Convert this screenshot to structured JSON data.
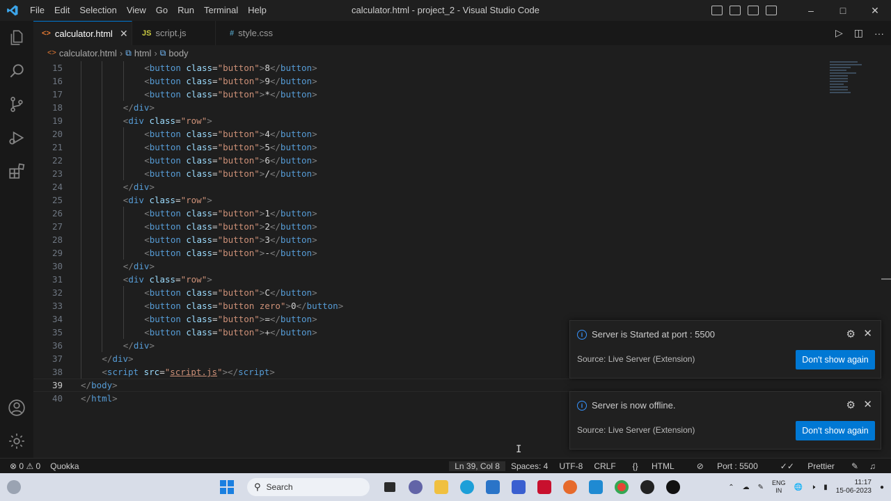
{
  "window": {
    "title": "calculator.html - project_2 - Visual Studio Code",
    "menu": [
      "File",
      "Edit",
      "Selection",
      "View",
      "Go",
      "Run",
      "Terminal",
      "Help"
    ]
  },
  "tabs": [
    {
      "label": "calculator.html",
      "icon": "<>",
      "active": true
    },
    {
      "label": "script.js",
      "icon": "JS",
      "active": false
    },
    {
      "label": "style.css",
      "icon": "#",
      "active": false
    }
  ],
  "breadcrumb": [
    "calculator.html",
    "html",
    "body"
  ],
  "editor": {
    "current_line": 39,
    "lines": [
      {
        "n": "15",
        "indent": 3,
        "tokens": [
          [
            "brk",
            "<"
          ],
          [
            "tag",
            "button"
          ],
          [
            "txt",
            " "
          ],
          [
            "attr",
            "class"
          ],
          [
            "txt",
            "="
          ],
          [
            "str",
            "\"button\""
          ],
          [
            "brk",
            ">"
          ],
          [
            "txt",
            "8"
          ],
          [
            "brk",
            "</"
          ],
          [
            "tag",
            "button"
          ],
          [
            "brk",
            ">"
          ]
        ]
      },
      {
        "n": "16",
        "indent": 3,
        "tokens": [
          [
            "brk",
            "<"
          ],
          [
            "tag",
            "button"
          ],
          [
            "txt",
            " "
          ],
          [
            "attr",
            "class"
          ],
          [
            "txt",
            "="
          ],
          [
            "str",
            "\"button\""
          ],
          [
            "brk",
            ">"
          ],
          [
            "txt",
            "9"
          ],
          [
            "brk",
            "</"
          ],
          [
            "tag",
            "button"
          ],
          [
            "brk",
            ">"
          ]
        ]
      },
      {
        "n": "17",
        "indent": 3,
        "tokens": [
          [
            "brk",
            "<"
          ],
          [
            "tag",
            "button"
          ],
          [
            "txt",
            " "
          ],
          [
            "attr",
            "class"
          ],
          [
            "txt",
            "="
          ],
          [
            "str",
            "\"button\""
          ],
          [
            "brk",
            ">"
          ],
          [
            "txt",
            "*"
          ],
          [
            "brk",
            "</"
          ],
          [
            "tag",
            "button"
          ],
          [
            "brk",
            ">"
          ]
        ]
      },
      {
        "n": "18",
        "indent": 2,
        "tokens": [
          [
            "brk",
            "</"
          ],
          [
            "tag",
            "div"
          ],
          [
            "brk",
            ">"
          ]
        ]
      },
      {
        "n": "19",
        "indent": 2,
        "tokens": [
          [
            "brk",
            "<"
          ],
          [
            "tag",
            "div"
          ],
          [
            "txt",
            " "
          ],
          [
            "attr",
            "class"
          ],
          [
            "txt",
            "="
          ],
          [
            "str",
            "\"row\""
          ],
          [
            "brk",
            ">"
          ]
        ]
      },
      {
        "n": "20",
        "indent": 3,
        "tokens": [
          [
            "brk",
            "<"
          ],
          [
            "tag",
            "button"
          ],
          [
            "txt",
            " "
          ],
          [
            "attr",
            "class"
          ],
          [
            "txt",
            "="
          ],
          [
            "str",
            "\"button\""
          ],
          [
            "brk",
            ">"
          ],
          [
            "txt",
            "4"
          ],
          [
            "brk",
            "</"
          ],
          [
            "tag",
            "button"
          ],
          [
            "brk",
            ">"
          ]
        ]
      },
      {
        "n": "21",
        "indent": 3,
        "tokens": [
          [
            "brk",
            "<"
          ],
          [
            "tag",
            "button"
          ],
          [
            "txt",
            " "
          ],
          [
            "attr",
            "class"
          ],
          [
            "txt",
            "="
          ],
          [
            "str",
            "\"button\""
          ],
          [
            "brk",
            ">"
          ],
          [
            "txt",
            "5"
          ],
          [
            "brk",
            "</"
          ],
          [
            "tag",
            "button"
          ],
          [
            "brk",
            ">"
          ]
        ]
      },
      {
        "n": "22",
        "indent": 3,
        "tokens": [
          [
            "brk",
            "<"
          ],
          [
            "tag",
            "button"
          ],
          [
            "txt",
            " "
          ],
          [
            "attr",
            "class"
          ],
          [
            "txt",
            "="
          ],
          [
            "str",
            "\"button\""
          ],
          [
            "brk",
            ">"
          ],
          [
            "txt",
            "6"
          ],
          [
            "brk",
            "</"
          ],
          [
            "tag",
            "button"
          ],
          [
            "brk",
            ">"
          ]
        ]
      },
      {
        "n": "23",
        "indent": 3,
        "tokens": [
          [
            "brk",
            "<"
          ],
          [
            "tag",
            "button"
          ],
          [
            "txt",
            " "
          ],
          [
            "attr",
            "class"
          ],
          [
            "txt",
            "="
          ],
          [
            "str",
            "\"button\""
          ],
          [
            "brk",
            ">"
          ],
          [
            "txt",
            "/"
          ],
          [
            "brk",
            "</"
          ],
          [
            "tag",
            "button"
          ],
          [
            "brk",
            ">"
          ]
        ]
      },
      {
        "n": "24",
        "indent": 2,
        "tokens": [
          [
            "brk",
            "</"
          ],
          [
            "tag",
            "div"
          ],
          [
            "brk",
            ">"
          ]
        ]
      },
      {
        "n": "25",
        "indent": 2,
        "tokens": [
          [
            "brk",
            "<"
          ],
          [
            "tag",
            "div"
          ],
          [
            "txt",
            " "
          ],
          [
            "attr",
            "class"
          ],
          [
            "txt",
            "="
          ],
          [
            "str",
            "\"row\""
          ],
          [
            "brk",
            ">"
          ]
        ]
      },
      {
        "n": "26",
        "indent": 3,
        "tokens": [
          [
            "brk",
            "<"
          ],
          [
            "tag",
            "button"
          ],
          [
            "txt",
            " "
          ],
          [
            "attr",
            "class"
          ],
          [
            "txt",
            "="
          ],
          [
            "str",
            "\"button\""
          ],
          [
            "brk",
            ">"
          ],
          [
            "txt",
            "1"
          ],
          [
            "brk",
            "</"
          ],
          [
            "tag",
            "button"
          ],
          [
            "brk",
            ">"
          ]
        ]
      },
      {
        "n": "27",
        "indent": 3,
        "tokens": [
          [
            "brk",
            "<"
          ],
          [
            "tag",
            "button"
          ],
          [
            "txt",
            " "
          ],
          [
            "attr",
            "class"
          ],
          [
            "txt",
            "="
          ],
          [
            "str",
            "\"button\""
          ],
          [
            "brk",
            ">"
          ],
          [
            "txt",
            "2"
          ],
          [
            "brk",
            "</"
          ],
          [
            "tag",
            "button"
          ],
          [
            "brk",
            ">"
          ]
        ]
      },
      {
        "n": "28",
        "indent": 3,
        "tokens": [
          [
            "brk",
            "<"
          ],
          [
            "tag",
            "button"
          ],
          [
            "txt",
            " "
          ],
          [
            "attr",
            "class"
          ],
          [
            "txt",
            "="
          ],
          [
            "str",
            "\"button\""
          ],
          [
            "brk",
            ">"
          ],
          [
            "txt",
            "3"
          ],
          [
            "brk",
            "</"
          ],
          [
            "tag",
            "button"
          ],
          [
            "brk",
            ">"
          ]
        ]
      },
      {
        "n": "29",
        "indent": 3,
        "tokens": [
          [
            "brk",
            "<"
          ],
          [
            "tag",
            "button"
          ],
          [
            "txt",
            " "
          ],
          [
            "attr",
            "class"
          ],
          [
            "txt",
            "="
          ],
          [
            "str",
            "\"button\""
          ],
          [
            "brk",
            ">"
          ],
          [
            "txt",
            "-"
          ],
          [
            "brk",
            "</"
          ],
          [
            "tag",
            "button"
          ],
          [
            "brk",
            ">"
          ]
        ]
      },
      {
        "n": "30",
        "indent": 2,
        "tokens": [
          [
            "brk",
            "</"
          ],
          [
            "tag",
            "div"
          ],
          [
            "brk",
            ">"
          ]
        ]
      },
      {
        "n": "31",
        "indent": 2,
        "tokens": [
          [
            "brk",
            "<"
          ],
          [
            "tag",
            "div"
          ],
          [
            "txt",
            " "
          ],
          [
            "attr",
            "class"
          ],
          [
            "txt",
            "="
          ],
          [
            "str",
            "\"row\""
          ],
          [
            "brk",
            ">"
          ]
        ]
      },
      {
        "n": "32",
        "indent": 3,
        "tokens": [
          [
            "brk",
            "<"
          ],
          [
            "tag",
            "button"
          ],
          [
            "txt",
            " "
          ],
          [
            "attr",
            "class"
          ],
          [
            "txt",
            "="
          ],
          [
            "str",
            "\"button\""
          ],
          [
            "brk",
            ">"
          ],
          [
            "txt",
            "C"
          ],
          [
            "brk",
            "</"
          ],
          [
            "tag",
            "button"
          ],
          [
            "brk",
            ">"
          ]
        ]
      },
      {
        "n": "33",
        "indent": 3,
        "tokens": [
          [
            "brk",
            "<"
          ],
          [
            "tag",
            "button"
          ],
          [
            "txt",
            " "
          ],
          [
            "attr",
            "class"
          ],
          [
            "txt",
            "="
          ],
          [
            "str",
            "\"button zero\""
          ],
          [
            "brk",
            ">"
          ],
          [
            "txt",
            "0"
          ],
          [
            "brk",
            "</"
          ],
          [
            "tag",
            "button"
          ],
          [
            "brk",
            ">"
          ]
        ]
      },
      {
        "n": "34",
        "indent": 3,
        "tokens": [
          [
            "brk",
            "<"
          ],
          [
            "tag",
            "button"
          ],
          [
            "txt",
            " "
          ],
          [
            "attr",
            "class"
          ],
          [
            "txt",
            "="
          ],
          [
            "str",
            "\"button\""
          ],
          [
            "brk",
            ">"
          ],
          [
            "txt",
            "="
          ],
          [
            "brk",
            "</"
          ],
          [
            "tag",
            "button"
          ],
          [
            "brk",
            ">"
          ]
        ]
      },
      {
        "n": "35",
        "indent": 3,
        "tokens": [
          [
            "brk",
            "<"
          ],
          [
            "tag",
            "button"
          ],
          [
            "txt",
            " "
          ],
          [
            "attr",
            "class"
          ],
          [
            "txt",
            "="
          ],
          [
            "str",
            "\"button\""
          ],
          [
            "brk",
            ">"
          ],
          [
            "txt",
            "+"
          ],
          [
            "brk",
            "</"
          ],
          [
            "tag",
            "button"
          ],
          [
            "brk",
            ">"
          ]
        ]
      },
      {
        "n": "36",
        "indent": 2,
        "tokens": [
          [
            "brk",
            "</"
          ],
          [
            "tag",
            "div"
          ],
          [
            "brk",
            ">"
          ]
        ]
      },
      {
        "n": "37",
        "indent": 1,
        "tokens": [
          [
            "brk",
            "</"
          ],
          [
            "tag",
            "div"
          ],
          [
            "brk",
            ">"
          ]
        ]
      },
      {
        "n": "38",
        "indent": 1,
        "tokens": [
          [
            "brk",
            "<"
          ],
          [
            "tag",
            "script"
          ],
          [
            "txt",
            " "
          ],
          [
            "attr",
            "src"
          ],
          [
            "txt",
            "="
          ],
          [
            "str",
            "\""
          ],
          [
            "strlink",
            "script.js"
          ],
          [
            "str",
            "\""
          ],
          [
            "brk",
            "></"
          ],
          [
            "tag",
            "script"
          ],
          [
            "brk",
            ">"
          ]
        ]
      },
      {
        "n": "39",
        "indent": 0,
        "tokens": [
          [
            "brk",
            "</"
          ],
          [
            "tag",
            "body"
          ],
          [
            "brk",
            ">"
          ]
        ]
      },
      {
        "n": "40",
        "indent": 0,
        "tokens": [
          [
            "brk",
            "</"
          ],
          [
            "tag",
            "html"
          ],
          [
            "brk",
            ">"
          ]
        ]
      }
    ]
  },
  "notifications": [
    {
      "message": "Server is Started at port : 5500",
      "source": "Source: Live Server (Extension)",
      "button": "Don't show again"
    },
    {
      "message": "Server is now offline.",
      "source": "Source: Live Server (Extension)",
      "button": "Don't show again"
    }
  ],
  "statusbar": {
    "errors": "0",
    "warnings": "0",
    "quokka": "Quokka",
    "position": "Ln 39, Col 8",
    "spaces": "Spaces: 4",
    "encoding": "UTF-8",
    "eol": "CRLF",
    "language": "HTML",
    "port": "Port : 5500",
    "prettier": "Prettier"
  },
  "taskbar": {
    "search_placeholder": "Search",
    "lang_top": "ENG",
    "lang_bottom": "IN",
    "time": "11:17",
    "date": "15-06-2023"
  },
  "colors": {
    "accent": "#0078d4",
    "info": "#3794ff"
  }
}
